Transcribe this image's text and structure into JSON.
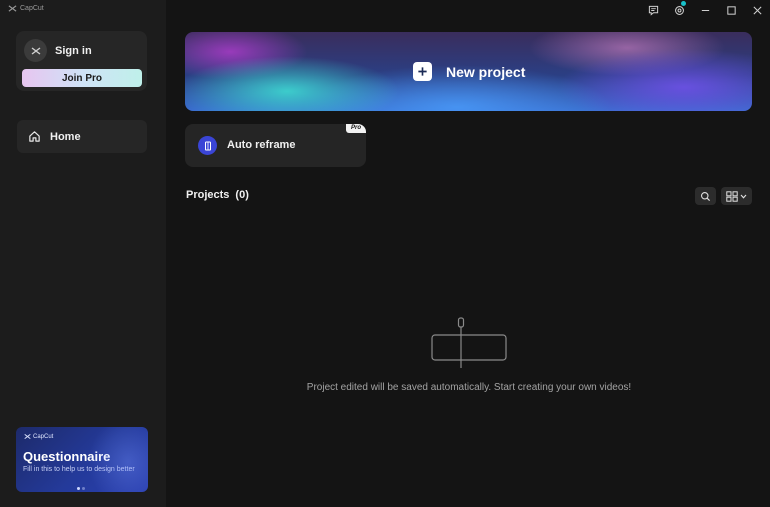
{
  "app": {
    "name": "CapCut"
  },
  "sidebar": {
    "sign_in_label": "Sign in",
    "join_pro_label": "Join Pro",
    "nav": [
      {
        "label": "Home",
        "icon": "home-icon",
        "active": true
      }
    ],
    "promo": {
      "brand": "CapCut",
      "title": "Questionnaire",
      "text": "Fill in this to help us to design better",
      "page_count": 2,
      "active_page": 1
    }
  },
  "titlebar": {
    "buttons": [
      "feedback-icon",
      "settings-icon",
      "minimize-icon",
      "maximize-icon",
      "close-icon"
    ],
    "settings_badge_color": "#19c0c9"
  },
  "main": {
    "new_project_label": "New project",
    "tools": [
      {
        "label": "Auto reframe",
        "badge": "Pro",
        "icon": "auto-reframe-icon"
      }
    ],
    "projects_title": "Projects",
    "projects_count": "(0)",
    "empty_message": "Project edited will be saved automatically. Start creating your own videos!"
  },
  "colors": {
    "background": "#141414",
    "sidebar": "#1c1c1c",
    "accent_cyan": "#19c0c9",
    "auto_reframe_icon_bg": "#3a45d6"
  }
}
